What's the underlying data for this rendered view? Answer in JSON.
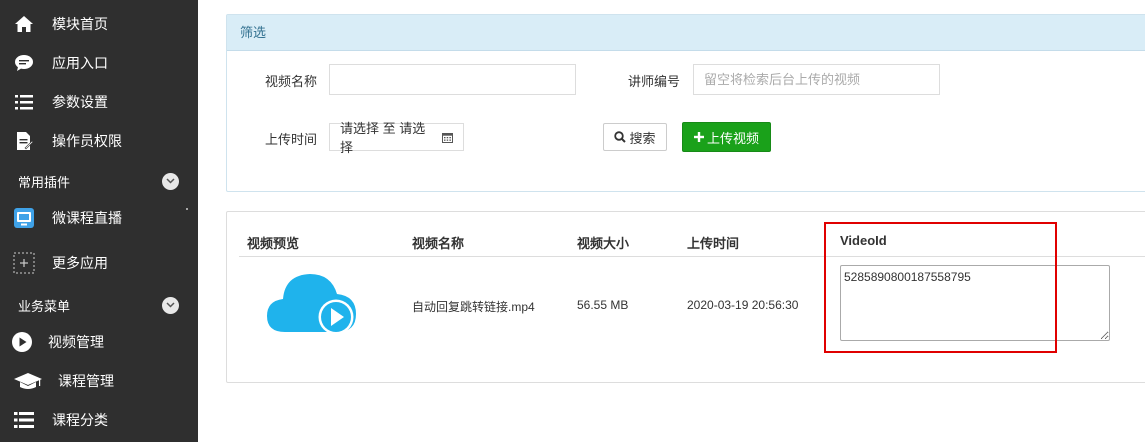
{
  "sidebar": {
    "items_top": [
      {
        "label": "模块首页",
        "icon": "home-icon"
      },
      {
        "label": "应用入口",
        "icon": "chat-bubble-icon"
      },
      {
        "label": "参数设置",
        "icon": "list-settings-icon"
      },
      {
        "label": "操作员权限",
        "icon": "document-edit-icon"
      }
    ],
    "section_plugins": "常用插件",
    "plugins": [
      {
        "label": "微课程直播",
        "icon": "live-broadcast-icon"
      },
      {
        "label": "更多应用",
        "icon": "add-dashed-icon"
      }
    ],
    "section_business": "业务菜单",
    "business": [
      {
        "label": "视频管理",
        "icon": "play-circle-icon"
      },
      {
        "label": "课程管理",
        "icon": "graduation-cap-icon"
      },
      {
        "label": "课程分类",
        "icon": "list-icon"
      }
    ]
  },
  "filter": {
    "title": "筛选",
    "video_name_label": "视频名称",
    "video_name_value": "",
    "lecturer_label": "讲师编号",
    "lecturer_placeholder": "留空将检索后台上传的视频",
    "upload_time_label": "上传时间",
    "date_range_text": "请选择 至 请选择",
    "search_label": "搜索",
    "upload_label": "上传视频"
  },
  "table": {
    "headers": [
      "视频预览",
      "视频名称",
      "视频大小",
      "上传时间",
      "VideoId"
    ],
    "rows": [
      {
        "name": "自动回复跳转链接.mp4",
        "size": "56.55 MB",
        "upload_time": "2020-03-19 20:56:30",
        "video_id": "5285890800187558795"
      }
    ]
  },
  "colors": {
    "sidebar_bg": "#2f2f2f",
    "filter_header_bg": "#d9edf7",
    "upload_button": "#1aa11a",
    "cloud_icon": "#1fb3ec",
    "highlight_box": "#e00000"
  }
}
